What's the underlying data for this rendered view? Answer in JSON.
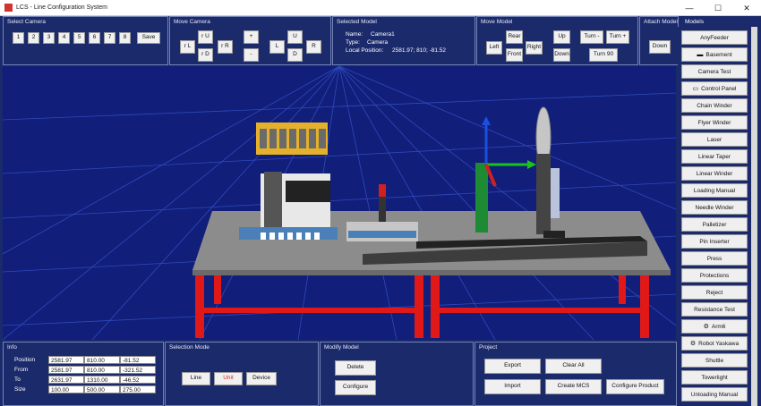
{
  "window": {
    "title": "LCS - Line Configuration System",
    "minimize": "—",
    "maximize": "☐",
    "close": "✕"
  },
  "select_camera": {
    "title": "Select Camera",
    "buttons": [
      "1",
      "2",
      "3",
      "4",
      "5",
      "6",
      "7",
      "8"
    ],
    "save": "Save"
  },
  "move_camera": {
    "title": "Move Camera",
    "rl": "r L",
    "ru": "r U",
    "rd": "r D",
    "rr": "r R",
    "plus": "+",
    "minus": "-",
    "l": "L",
    "u": "U",
    "d": "D",
    "r": "R"
  },
  "selected_model": {
    "title": "Selected Model",
    "name_label": "Name:",
    "name": "Camera1",
    "type_label": "Type:",
    "type": "Camera",
    "pos_label": "Local Position:",
    "pos": "2581.97; 810; -81.52"
  },
  "move_model": {
    "title": "Move Model",
    "left": "Left",
    "rear": "Rear",
    "front": "Front",
    "right": "Right",
    "up": "Up",
    "down": "Down",
    "turn_minus": "Turn -",
    "turn_plus": "Turn +",
    "turn90": "Turn 90"
  },
  "attach": {
    "title": "Attach Model",
    "down": "Down"
  },
  "models_header": "Models",
  "models": [
    {
      "label": "AnyFeeder",
      "icon": ""
    },
    {
      "label": "Basement",
      "icon": "▬"
    },
    {
      "label": "Camera Test",
      "icon": ""
    },
    {
      "label": "Control Panel",
      "icon": "▭"
    },
    {
      "label": "Chain Winder",
      "icon": ""
    },
    {
      "label": "Flyer Winder",
      "icon": ""
    },
    {
      "label": "Laser",
      "icon": ""
    },
    {
      "label": "Linear Taper",
      "icon": ""
    },
    {
      "label": "Linear Winder",
      "icon": ""
    },
    {
      "label": "Loading Manual",
      "icon": ""
    },
    {
      "label": "Needle Winder",
      "icon": ""
    },
    {
      "label": "Palletizer",
      "icon": ""
    },
    {
      "label": "Pin Inserter",
      "icon": ""
    },
    {
      "label": "Press",
      "icon": ""
    },
    {
      "label": "Protections",
      "icon": ""
    },
    {
      "label": "Reject",
      "icon": ""
    },
    {
      "label": "Resistance Test",
      "icon": ""
    },
    {
      "label": "Arm6",
      "icon": "⚙"
    },
    {
      "label": "Robot Yaskawa",
      "icon": "⚙"
    },
    {
      "label": "Shuttle",
      "icon": ""
    },
    {
      "label": "Towerlight",
      "icon": ""
    },
    {
      "label": "Unloading Manual",
      "icon": ""
    }
  ],
  "info": {
    "title": "Info",
    "rows": [
      {
        "label": "Position",
        "v": [
          "2581.97",
          "810.00",
          "-81.52"
        ]
      },
      {
        "label": "From",
        "v": [
          "2581.97",
          "810.00",
          "-321.52"
        ]
      },
      {
        "label": "To",
        "v": [
          "2631.97",
          "1310.00",
          "-46.52"
        ]
      },
      {
        "label": "Size",
        "v": [
          "100.00",
          "500.00",
          "275.00"
        ]
      }
    ]
  },
  "selection_mode": {
    "title": "Selection Mode",
    "line": "Line",
    "unit": "Unit",
    "device": "Device",
    "active_color": "#e02020"
  },
  "modify_model": {
    "title": "Modify Model",
    "delete": "Delete",
    "configure": "Configure"
  },
  "project": {
    "title": "Project",
    "export": "Export",
    "clear_all": "Clear All",
    "import": "Import",
    "create_mcs": "Create MCS",
    "configure_product": "Configure Product"
  },
  "colors": {
    "background": "#1b2a6b",
    "viewport": "#111e7a",
    "frame": "#e01818",
    "table_top": "#8c8c8c",
    "axis_x": "#1cc21c",
    "axis_y": "#1c4ee0",
    "axis_z": "#d02020"
  }
}
